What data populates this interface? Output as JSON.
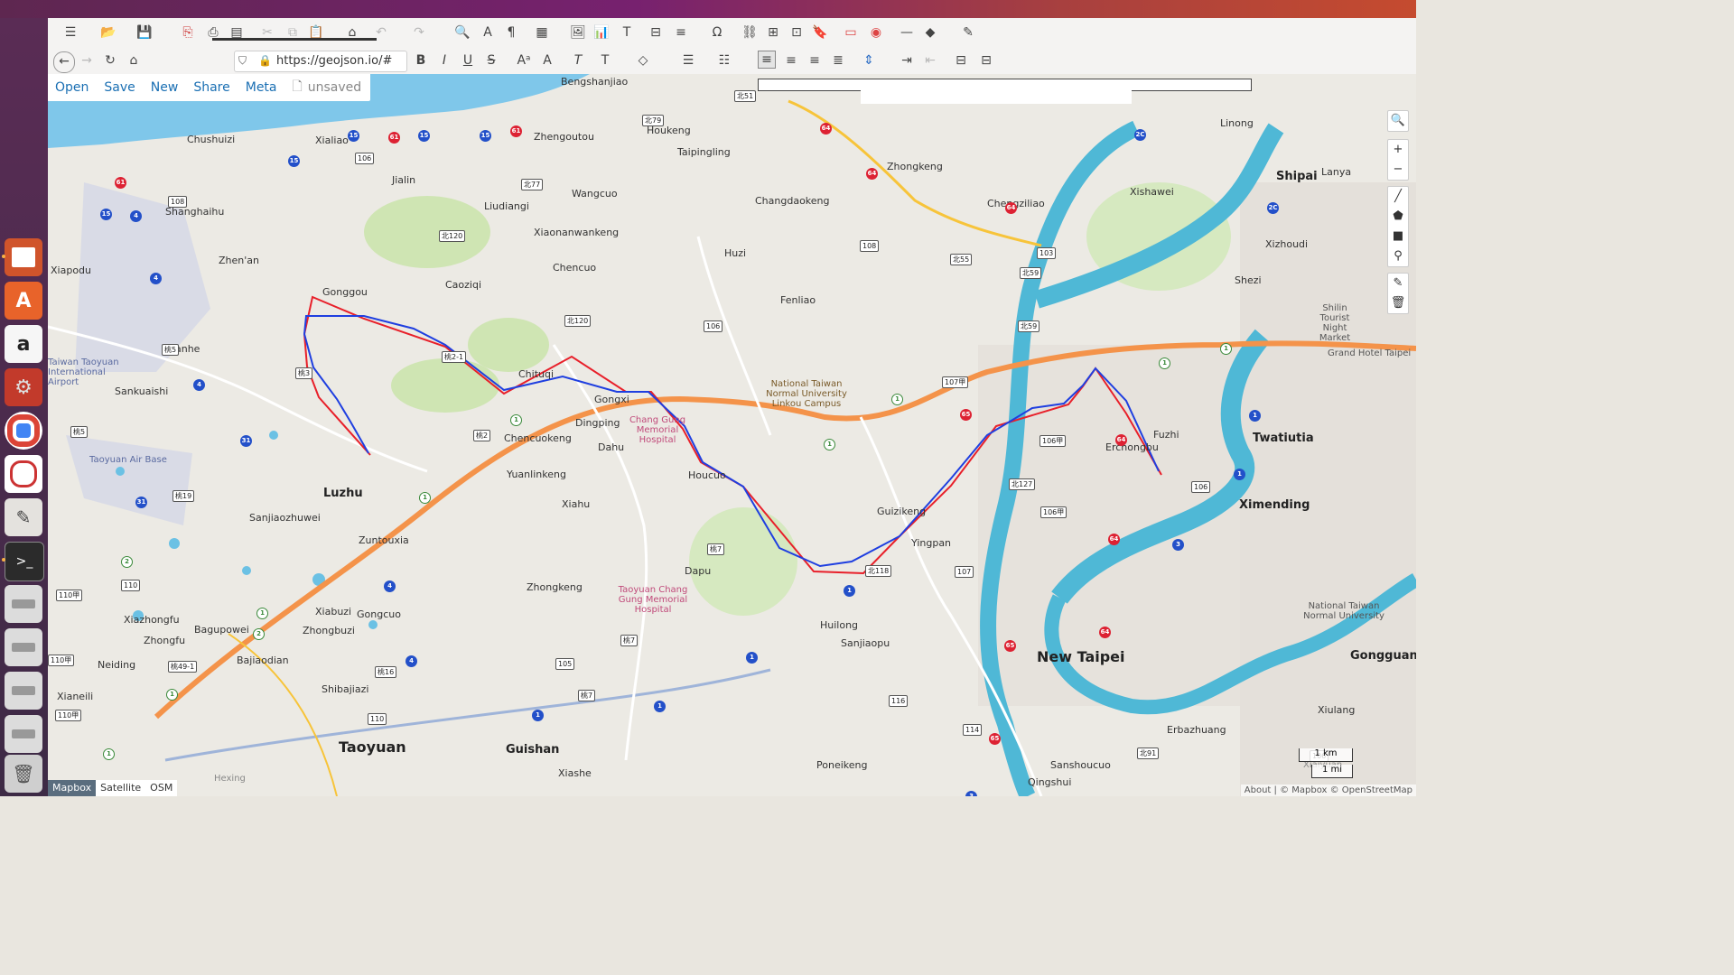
{
  "browser": {
    "url": "https://geojson.io/#"
  },
  "geojson_menu": {
    "items": [
      "Open",
      "Save",
      "New",
      "Share",
      "Meta"
    ],
    "status": "unsaved"
  },
  "layers": {
    "options": [
      "Mapbox",
      "Satellite",
      "OSM"
    ],
    "active": "Mapbox"
  },
  "attribution": "About | © Mapbox © OpenStreetMap",
  "scale": {
    "label1": "1 km",
    "label2": "1 mi"
  },
  "map_labels": {
    "cities": [
      "Taoyuan",
      "New Taipei",
      "Luzhu",
      "Guishan",
      "Ximending",
      "Twatiutia",
      "Shipai",
      "Gongguan",
      "Dahu"
    ],
    "places": [
      "Bengshanjiao",
      "Chushuizi",
      "Xialiao",
      "Zhengoutou",
      "Houkeng",
      "Taipingling",
      "Zhongkeng",
      "Changdaokeng",
      "Chengziliao",
      "Xishawei",
      "Linong",
      "Lanya",
      "Xizhoudi",
      "Shezi",
      "Jialin",
      "Liudiangi",
      "Wangcuo",
      "Xiaonanwankeng",
      "Huzi",
      "Chencuo",
      "Gonggou",
      "Caoziqi",
      "Fenliao",
      "Zhen'an",
      "Xiapodu",
      "Shanghaihu",
      "Sanhe",
      "Sankuaishi",
      "Chituqi",
      "Gongxi",
      "Dingping",
      "Chencuokeng",
      "Yuanlinkeng",
      "Houcuo",
      "Xiahu",
      "Guizikeng",
      "Yingpan",
      "Erchongbu",
      "Fuzhi",
      "Sanjiaozhuwei",
      "Zuntouxia",
      "Zhongkeng",
      "Dapu",
      "Huilong",
      "Sanjiaopu",
      "Xiabuzi",
      "Gongcuo",
      "Zhongbuzi",
      "Xiazhongfu",
      "Zhongfu",
      "Bagupowei",
      "Bajiaodian",
      "Shibajiazi",
      "Neiding",
      "Xianeili",
      "Xiashe",
      "Poneikeng",
      "Sanshoucuo",
      "Qingshui",
      "Erbazhuang",
      "Xiulang",
      "Xiaiyuan",
      "Hexing"
    ],
    "pois": [
      "Chang Gung Memorial Hospital",
      "Taoyuan Chang Gung Memorial Hospital",
      "National Taiwan Normal University Linkou Campus",
      "Taoyuan Air Base",
      "Taiwan Taoyuan International Airport",
      "Shilin Tourist Night Market",
      "Grand Hotel Taipei",
      "National Taiwan Normal University"
    ]
  },
  "colors": {
    "route_red": "#e8202a",
    "route_blue": "#1f3fe0",
    "highway": "#f4934a",
    "river": "#4fb8d6",
    "sea": "#7fc7ea"
  },
  "left_launcher": {
    "apps": [
      "impress",
      "software-center",
      "amazon",
      "settings",
      "chrome",
      "app",
      "text-editor",
      "terminal",
      "disk1",
      "disk2",
      "disk3",
      "disk4",
      "trash"
    ]
  }
}
